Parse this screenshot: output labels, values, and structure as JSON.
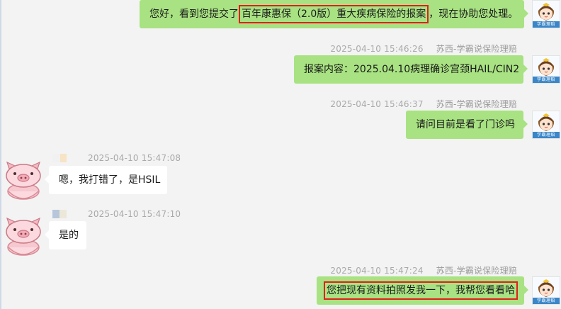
{
  "agent": {
    "avatar_label": "学霸理赔"
  },
  "messages": [
    {
      "side": "right",
      "time": "",
      "sender": "",
      "parts": [
        "您好，看到您提交了",
        "百年康惠保（2.0版）重大疾病保险的报案",
        "，现在协助您处理。"
      ],
      "highlight_part": 1
    },
    {
      "side": "right",
      "time": "2025-04-10 15:46:26",
      "sender": "苏西-学霸说保险理赔",
      "text": "报案内容：2025.04.10病理确诊宫颈HAIL/CIN2"
    },
    {
      "side": "right",
      "time": "2025-04-10 15:46:37",
      "sender": "苏西-学霸说保险理赔",
      "text": "请问目前是看了门诊吗"
    },
    {
      "side": "left",
      "time": "2025-04-10 15:47:08",
      "text": "嗯，我打错了，是HSIL"
    },
    {
      "side": "left",
      "time": "2025-04-10 15:47:10",
      "text": "是的"
    },
    {
      "side": "right",
      "time": "2025-04-10 15:47:24",
      "sender": "苏西-学霸说保险理赔",
      "text": "您把现有资料拍照发我一下，我帮您看看哈",
      "highlighted": true
    }
  ],
  "colors": {
    "outgoing_bubble": "#a8e282",
    "incoming_bubble": "#ffffff",
    "highlight": "#e0201b",
    "background": "#f3f3f3"
  }
}
